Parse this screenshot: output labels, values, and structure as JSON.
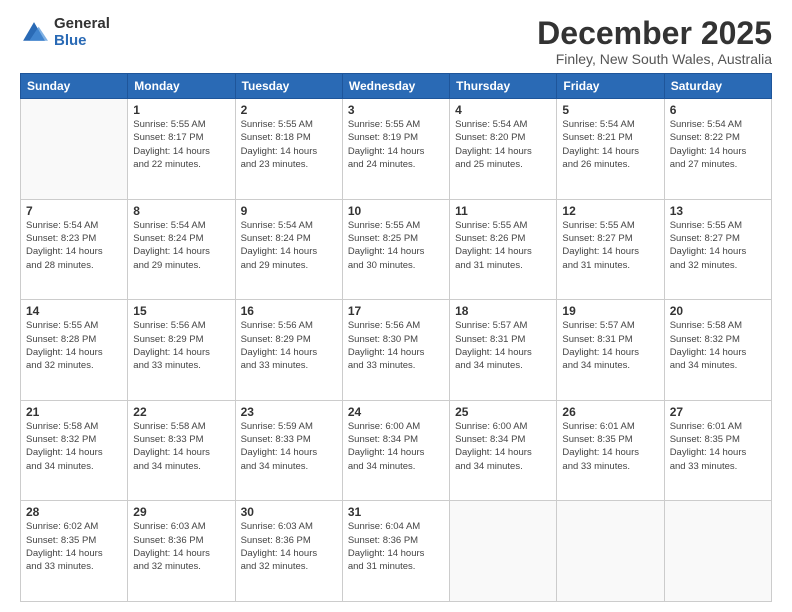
{
  "logo": {
    "general": "General",
    "blue": "Blue"
  },
  "header": {
    "month": "December 2025",
    "location": "Finley, New South Wales, Australia"
  },
  "weekdays": [
    "Sunday",
    "Monday",
    "Tuesday",
    "Wednesday",
    "Thursday",
    "Friday",
    "Saturday"
  ],
  "weeks": [
    [
      {
        "day": "",
        "info": ""
      },
      {
        "day": "1",
        "info": "Sunrise: 5:55 AM\nSunset: 8:17 PM\nDaylight: 14 hours\nand 22 minutes."
      },
      {
        "day": "2",
        "info": "Sunrise: 5:55 AM\nSunset: 8:18 PM\nDaylight: 14 hours\nand 23 minutes."
      },
      {
        "day": "3",
        "info": "Sunrise: 5:55 AM\nSunset: 8:19 PM\nDaylight: 14 hours\nand 24 minutes."
      },
      {
        "day": "4",
        "info": "Sunrise: 5:54 AM\nSunset: 8:20 PM\nDaylight: 14 hours\nand 25 minutes."
      },
      {
        "day": "5",
        "info": "Sunrise: 5:54 AM\nSunset: 8:21 PM\nDaylight: 14 hours\nand 26 minutes."
      },
      {
        "day": "6",
        "info": "Sunrise: 5:54 AM\nSunset: 8:22 PM\nDaylight: 14 hours\nand 27 minutes."
      }
    ],
    [
      {
        "day": "7",
        "info": "Sunrise: 5:54 AM\nSunset: 8:23 PM\nDaylight: 14 hours\nand 28 minutes."
      },
      {
        "day": "8",
        "info": "Sunrise: 5:54 AM\nSunset: 8:24 PM\nDaylight: 14 hours\nand 29 minutes."
      },
      {
        "day": "9",
        "info": "Sunrise: 5:54 AM\nSunset: 8:24 PM\nDaylight: 14 hours\nand 29 minutes."
      },
      {
        "day": "10",
        "info": "Sunrise: 5:55 AM\nSunset: 8:25 PM\nDaylight: 14 hours\nand 30 minutes."
      },
      {
        "day": "11",
        "info": "Sunrise: 5:55 AM\nSunset: 8:26 PM\nDaylight: 14 hours\nand 31 minutes."
      },
      {
        "day": "12",
        "info": "Sunrise: 5:55 AM\nSunset: 8:27 PM\nDaylight: 14 hours\nand 31 minutes."
      },
      {
        "day": "13",
        "info": "Sunrise: 5:55 AM\nSunset: 8:27 PM\nDaylight: 14 hours\nand 32 minutes."
      }
    ],
    [
      {
        "day": "14",
        "info": "Sunrise: 5:55 AM\nSunset: 8:28 PM\nDaylight: 14 hours\nand 32 minutes."
      },
      {
        "day": "15",
        "info": "Sunrise: 5:56 AM\nSunset: 8:29 PM\nDaylight: 14 hours\nand 33 minutes."
      },
      {
        "day": "16",
        "info": "Sunrise: 5:56 AM\nSunset: 8:29 PM\nDaylight: 14 hours\nand 33 minutes."
      },
      {
        "day": "17",
        "info": "Sunrise: 5:56 AM\nSunset: 8:30 PM\nDaylight: 14 hours\nand 33 minutes."
      },
      {
        "day": "18",
        "info": "Sunrise: 5:57 AM\nSunset: 8:31 PM\nDaylight: 14 hours\nand 34 minutes."
      },
      {
        "day": "19",
        "info": "Sunrise: 5:57 AM\nSunset: 8:31 PM\nDaylight: 14 hours\nand 34 minutes."
      },
      {
        "day": "20",
        "info": "Sunrise: 5:58 AM\nSunset: 8:32 PM\nDaylight: 14 hours\nand 34 minutes."
      }
    ],
    [
      {
        "day": "21",
        "info": "Sunrise: 5:58 AM\nSunset: 8:32 PM\nDaylight: 14 hours\nand 34 minutes."
      },
      {
        "day": "22",
        "info": "Sunrise: 5:58 AM\nSunset: 8:33 PM\nDaylight: 14 hours\nand 34 minutes."
      },
      {
        "day": "23",
        "info": "Sunrise: 5:59 AM\nSunset: 8:33 PM\nDaylight: 14 hours\nand 34 minutes."
      },
      {
        "day": "24",
        "info": "Sunrise: 6:00 AM\nSunset: 8:34 PM\nDaylight: 14 hours\nand 34 minutes."
      },
      {
        "day": "25",
        "info": "Sunrise: 6:00 AM\nSunset: 8:34 PM\nDaylight: 14 hours\nand 34 minutes."
      },
      {
        "day": "26",
        "info": "Sunrise: 6:01 AM\nSunset: 8:35 PM\nDaylight: 14 hours\nand 33 minutes."
      },
      {
        "day": "27",
        "info": "Sunrise: 6:01 AM\nSunset: 8:35 PM\nDaylight: 14 hours\nand 33 minutes."
      }
    ],
    [
      {
        "day": "28",
        "info": "Sunrise: 6:02 AM\nSunset: 8:35 PM\nDaylight: 14 hours\nand 33 minutes."
      },
      {
        "day": "29",
        "info": "Sunrise: 6:03 AM\nSunset: 8:36 PM\nDaylight: 14 hours\nand 32 minutes."
      },
      {
        "day": "30",
        "info": "Sunrise: 6:03 AM\nSunset: 8:36 PM\nDaylight: 14 hours\nand 32 minutes."
      },
      {
        "day": "31",
        "info": "Sunrise: 6:04 AM\nSunset: 8:36 PM\nDaylight: 14 hours\nand 31 minutes."
      },
      {
        "day": "",
        "info": ""
      },
      {
        "day": "",
        "info": ""
      },
      {
        "day": "",
        "info": ""
      }
    ]
  ]
}
